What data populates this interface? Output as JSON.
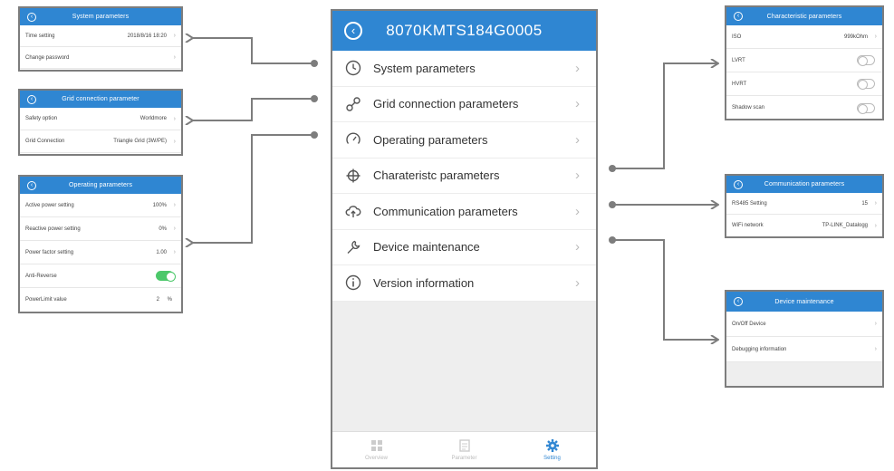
{
  "phone": {
    "title": "8070KMTS184G0005",
    "menu": [
      {
        "label": "System parameters",
        "icon": "clock-icon"
      },
      {
        "label": "Grid connection parameters",
        "icon": "link-icon"
      },
      {
        "label": "Operating parameters",
        "icon": "gauge-icon"
      },
      {
        "label": "Charateristc parameters",
        "icon": "crosshair-icon"
      },
      {
        "label": "Communication parameters",
        "icon": "cloud-upload-icon"
      },
      {
        "label": "Device maintenance",
        "icon": "wrench-icon"
      },
      {
        "label": "Version information",
        "icon": "info-icon"
      }
    ],
    "tabs": [
      {
        "label": "Overview",
        "icon": "grid-icon"
      },
      {
        "label": "Parameter",
        "icon": "document-icon"
      },
      {
        "label": "Setting",
        "icon": "gear-icon",
        "active": true
      }
    ]
  },
  "system_panel": {
    "title": "System parameters",
    "rows": [
      {
        "label": "Time setting",
        "value": "2018/8/16 18:20"
      },
      {
        "label": "Change password",
        "value": ""
      }
    ]
  },
  "grid_panel": {
    "title": "Grid connection parameter",
    "rows": [
      {
        "label": "Safety option",
        "value": "Worldmore"
      },
      {
        "label": "Grid Connection",
        "value": "Triangle Grid (3W/PE)"
      }
    ]
  },
  "operating_panel": {
    "title": "Operating parameters",
    "rows": [
      {
        "label": "Active power setting",
        "value": "100%"
      },
      {
        "label": "Reactive power setting",
        "value": "0%"
      },
      {
        "label": "Power factor setting",
        "value": "1.00"
      },
      {
        "label": "Anti-Reverse",
        "toggle": true
      },
      {
        "label": "PowerLimit value",
        "value": "2",
        "unit": "%"
      }
    ]
  },
  "characteristic_panel": {
    "title": "Characteristic parameters",
    "rows": [
      {
        "label": "ISO",
        "value": "999kOhm"
      },
      {
        "label": "LVRT",
        "toggle": false
      },
      {
        "label": "HVRT",
        "toggle": false
      },
      {
        "label": "Shadow scan",
        "toggle": false
      }
    ]
  },
  "communication_panel": {
    "title": "Communication parameters",
    "rows": [
      {
        "label": "RS485 Setting",
        "value": "15"
      },
      {
        "label": "WiFi network",
        "value": "TP-LINK_Datalogg"
      }
    ]
  },
  "maintenance_panel": {
    "title": "Device maintenance",
    "rows": [
      {
        "label": "On/Off Device",
        "value": ""
      },
      {
        "label": "Debugging information",
        "value": ""
      }
    ]
  },
  "colors": {
    "header_blue": "#2f86d2",
    "connector_gray": "#7d7d7d",
    "toggle_green": "#4cc86a"
  }
}
